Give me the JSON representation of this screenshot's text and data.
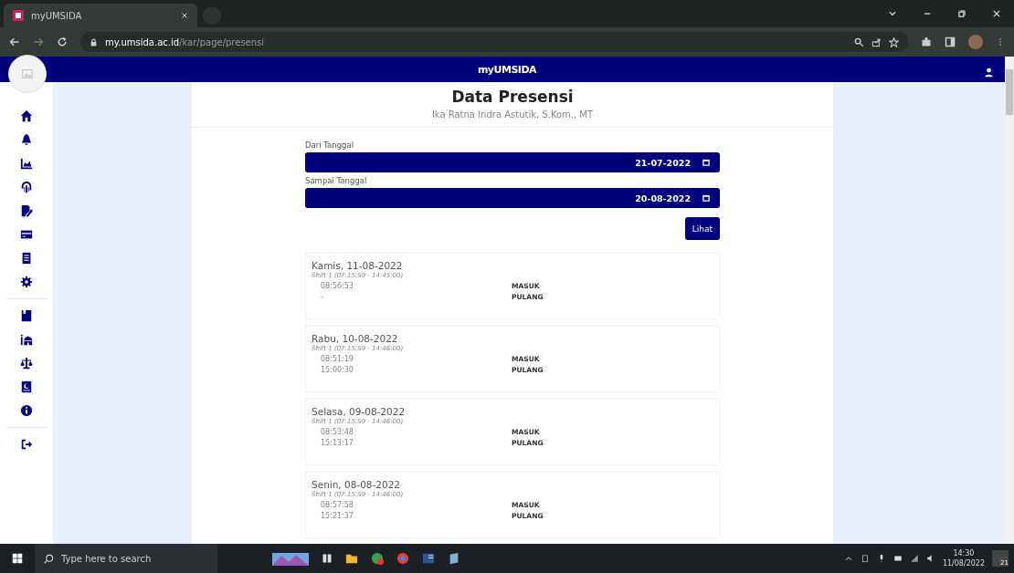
{
  "browser": {
    "tab_title": "myUMSIDA",
    "url_host": "my.umsida.ac.id",
    "url_path": "/kar/page/presensi"
  },
  "header": {
    "title": "myUMSIDA"
  },
  "page": {
    "title": "Data Presensi",
    "subtitle": "Ika Ratna Indra Astutik, S.Kom., MT"
  },
  "filters": [
    {
      "label": "Dari Tanggal",
      "value": "21-07-2022"
    },
    {
      "label": "Sampai Tanggal",
      "value": "20-08-2022"
    }
  ],
  "submit_button": "Lihat",
  "records": [
    {
      "date": "Kamis, 11-08-2022",
      "shift": "Shift 1 (07:15:59 - 14:45:00)",
      "entries": [
        {
          "time": "08:56:53",
          "type": "MASUK"
        },
        {
          "time": "-",
          "type": "PULANG"
        }
      ]
    },
    {
      "date": "Rabu, 10-08-2022",
      "shift": "Shift 1 (07:15:59 - 14:46:00)",
      "entries": [
        {
          "time": "08:51:19",
          "type": "MASUK"
        },
        {
          "time": "15:00:30",
          "type": "PULANG"
        }
      ]
    },
    {
      "date": "Selasa, 09-08-2022",
      "shift": "Shift 1 (07:15:59 - 14:46:00)",
      "entries": [
        {
          "time": "08:53:48",
          "type": "MASUK"
        },
        {
          "time": "15:13:17",
          "type": "PULANG"
        }
      ]
    },
    {
      "date": "Senin, 08-08-2022",
      "shift": "Shift 1 (07:15:59 - 14:46:00)",
      "entries": [
        {
          "time": "08:57:58",
          "type": "MASUK"
        },
        {
          "time": "15:21:37",
          "type": "PULANG"
        }
      ]
    }
  ],
  "taskbar": {
    "search_placeholder": "Type here to search",
    "time": "14:30",
    "date": "11/08/2022",
    "notifications": "21"
  }
}
